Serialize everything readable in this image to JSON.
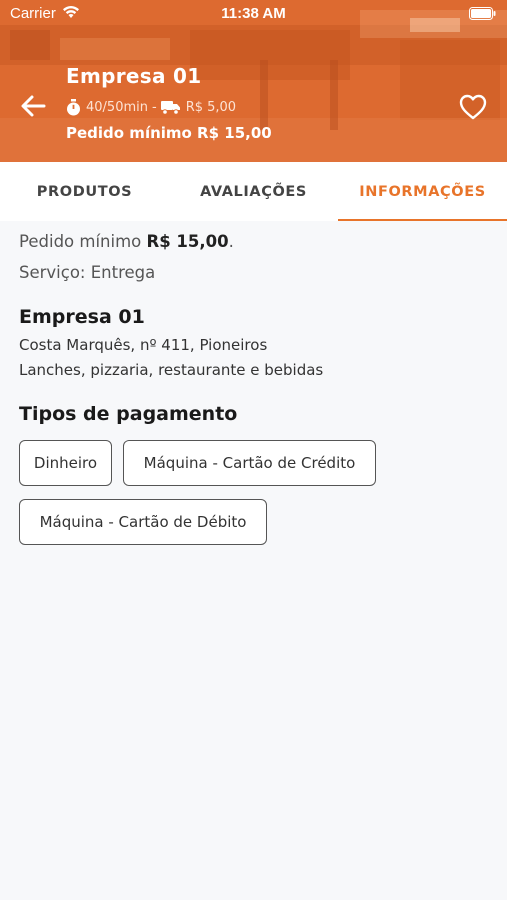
{
  "status_bar": {
    "carrier": "Carrier",
    "time": "11:38 AM"
  },
  "header": {
    "title": "Empresa 01",
    "delivery_time": "40/50min",
    "separator": "-",
    "delivery_fee": "R$ 5,00",
    "min_order": "Pedido mínimo R$ 15,00"
  },
  "tabs": [
    {
      "label": "PRODUTOS",
      "active": false
    },
    {
      "label": "AVALIAÇÕES",
      "active": false
    },
    {
      "label": "INFORMAÇÕES",
      "active": true
    }
  ],
  "info": {
    "min_order_label": "Pedido mínimo ",
    "min_order_value": "R$ 15,00",
    "min_order_suffix": ".",
    "service": "Serviço: Entrega",
    "business_name": "Empresa 01",
    "address": "Costa Marquês, nº 411, Pioneiros",
    "categories": "Lanches, pizzaria, restaurante e bebidas"
  },
  "payment": {
    "title": "Tipos de pagamento",
    "options": [
      "Dinheiro",
      "Máquina - Cartão de Crédito",
      "Máquina - Cartão de Débito"
    ]
  },
  "colors": {
    "accent": "#e8742a",
    "header": "#df6c31"
  }
}
